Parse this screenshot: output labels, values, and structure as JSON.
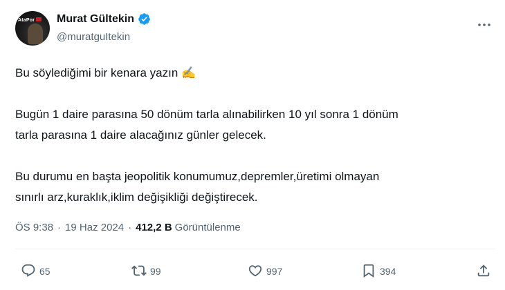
{
  "author": {
    "display_name": "Murat Gültekin",
    "handle": "@muratguItekin",
    "avatar_text": "AtaPor"
  },
  "icons": {
    "verified": "verified-badge-icon",
    "more": "more-options-icon",
    "reply": "reply-icon",
    "retweet": "retweet-icon",
    "like": "like-icon",
    "bookmark": "bookmark-icon",
    "share": "share-icon"
  },
  "colors": {
    "verified_badge": "#1d9bf0",
    "text_primary": "#0f1419",
    "text_secondary": "#536471"
  },
  "tweet": {
    "line1": "Bu söylediğimi bir kenara yazın ✍️",
    "para2_line1": "Bugün 1 daire parasına 50 dönüm tarla alınabilirken 10 yıl sonra 1 dönüm",
    "para2_line2": "tarla parasına 1 daire alacağınız günler gelecek.",
    "para3_line1": "Bu durumu en başta jeopolitik konumumuz,depremler,üretimi olmayan",
    "para3_line2": "sınırlı arz,kuraklık,iklim değişikliği değiştirecek."
  },
  "meta": {
    "time": "ÖS 9:38",
    "separator": "·",
    "date": "19 Haz 2024",
    "views_count": "412,2 B",
    "views_label": "Görüntülenme"
  },
  "actions": {
    "replies": "65",
    "retweets": "99",
    "likes": "997",
    "bookmarks": "394"
  }
}
